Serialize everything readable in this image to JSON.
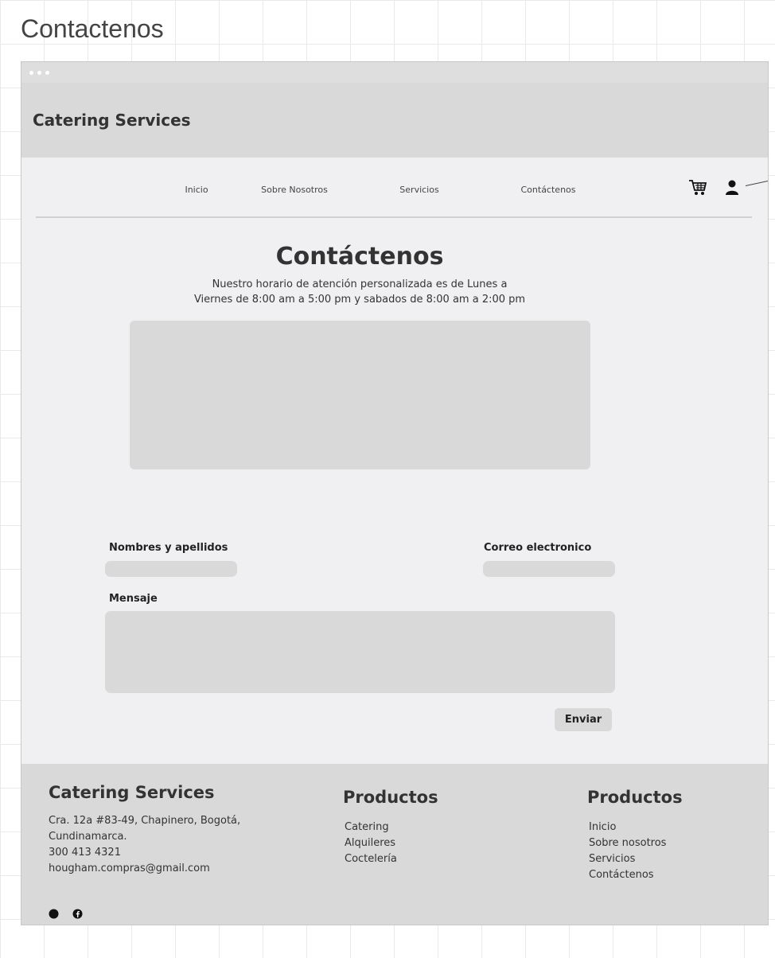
{
  "canvas_title": "Contactenos",
  "header": {
    "brand": "Catering Services"
  },
  "nav": {
    "items": [
      "Inicio",
      "Sobre Nosotros",
      "Servicios",
      "Contáctenos"
    ],
    "icons": [
      "cart-icon",
      "user-icon"
    ]
  },
  "page": {
    "title": "Contáctenos",
    "hours_line1": "Nuestro horario de atención personalizada es de Lunes a",
    "hours_line2": "Viernes de 8:00 am a 5:00 pm y sabados de 8:00 am a 2:00 pm"
  },
  "form": {
    "name_label": "Nombres y apellidos",
    "email_label": "Correo electronico",
    "message_label": "Mensaje",
    "submit_label": "Enviar"
  },
  "footer": {
    "brand": "Catering Services",
    "address_line1": "Cra. 12a #83-49, Chapinero, Bogotá,",
    "address_line2": "Cundinamarca.",
    "phone": "300 413 4321",
    "email": "hougham.compras@gmail.com",
    "col2_title": "Productos",
    "col2_items": [
      "Catering",
      "Alquileres",
      "Coctelería"
    ],
    "col3_title": "Productos",
    "col3_items": [
      "Inicio",
      "Sobre nosotros",
      "Servicios",
      "Contáctenos"
    ],
    "social_icons": [
      "circle-social-icon",
      "facebook-icon"
    ]
  }
}
